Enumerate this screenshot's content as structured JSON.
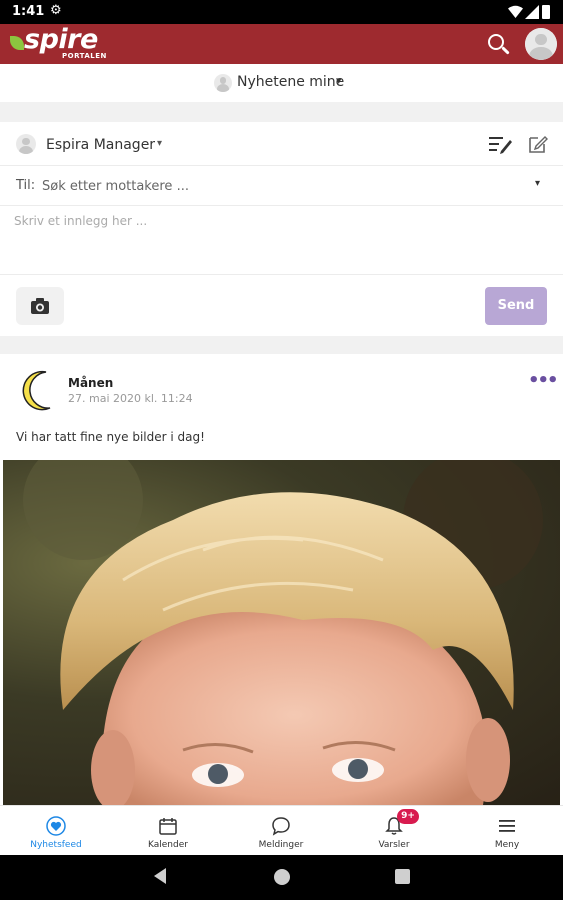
{
  "status_bar": {
    "time": "1:41"
  },
  "app": {
    "logo_text": "spire",
    "logo_subtext": "PORTALEN",
    "brand_color": "#9e2a2f"
  },
  "feed_selector": {
    "label": "Nyhetene mine"
  },
  "composer": {
    "sender_name": "Espira Manager",
    "to_label": "Til:",
    "to_placeholder": "Søk etter mottakere ...",
    "post_placeholder": "Skriv et innlegg her ...",
    "send_label": "Send"
  },
  "post": {
    "author": "Månen",
    "date": "27. mai 2020 kl. 11:24",
    "text": "Vi har tatt fine nye bilder i dag!"
  },
  "tabs": [
    {
      "label": "Nyhetsfeed",
      "icon": "heart-icon",
      "active": true
    },
    {
      "label": "Kalender",
      "icon": "calendar-icon"
    },
    {
      "label": "Meldinger",
      "icon": "chat-icon"
    },
    {
      "label": "Varsler",
      "icon": "bell-icon",
      "badge": "9+"
    },
    {
      "label": "Meny",
      "icon": "menu-icon"
    }
  ],
  "colors": {
    "accent": "#1e88e5",
    "send_disabled": "#b8a7d5",
    "badge": "#d81b4f",
    "more_menu": "#6a4fa0"
  }
}
